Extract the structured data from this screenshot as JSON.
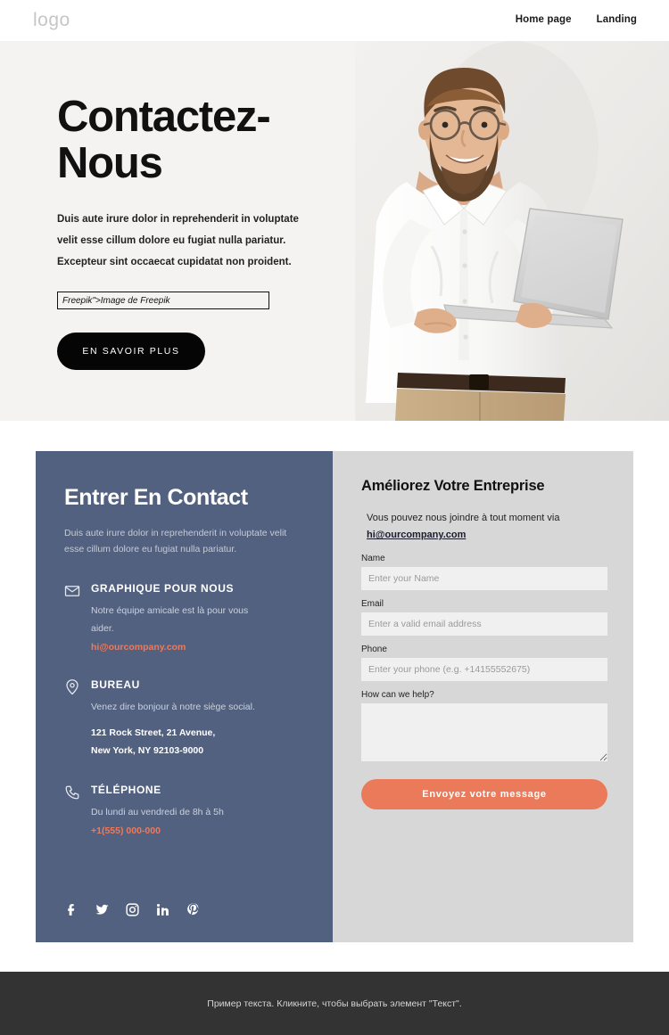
{
  "header": {
    "logo": "logo",
    "nav": [
      {
        "label": "Home page"
      },
      {
        "label": "Landing"
      }
    ]
  },
  "hero": {
    "title_line1": "Contactez-",
    "title_line2": "Nous",
    "paragraph_line1": "Duis aute irure dolor in reprehenderit in voluptate",
    "paragraph_line2": "velit esse cillum dolore eu fugiat nulla pariatur.",
    "paragraph_line3": "Excepteur sint occaecat cupidatat non proident.",
    "credit": "Freepik\">Image de Freepik",
    "cta_label": "EN SAVOIR PLUS",
    "image_alt": "Smiling bearded man with glasses in a white shirt holding a silver laptop",
    "background_color": "#f4f3f1"
  },
  "contact": {
    "left": {
      "title": "Entrer En Contact",
      "subtitle_line1": "Duis aute irure dolor in reprehenderit in voluptate velit",
      "subtitle_line2": "esse cillum dolore eu fugiat nulla pariatur.",
      "background_color": "#526180",
      "blocks": [
        {
          "icon": "envelope-icon",
          "heading": "GRAPHIQUE POUR NOUS",
          "line1": "Notre équipe amicale est là pour vous",
          "line2": "aider.",
          "link": "hi@ourcompany.com"
        },
        {
          "icon": "map-pin-icon",
          "heading": "BUREAU",
          "line1": "Venez dire bonjour à notre siège social.",
          "line2": "121 Rock Street, 21 Avenue,",
          "line3": "New York, NY 92103-9000"
        },
        {
          "icon": "phone-icon",
          "heading": "TÉLÉPHONE",
          "line1": "Du lundi au vendredi de 8h à 5h",
          "link": "+1(555) 000-000"
        }
      ],
      "socials": [
        {
          "name": "facebook-icon"
        },
        {
          "name": "twitter-icon"
        },
        {
          "name": "instagram-icon"
        },
        {
          "name": "linkedin-icon"
        },
        {
          "name": "pinterest-icon"
        }
      ],
      "link_color": "#ec7a5c"
    },
    "right": {
      "title": "Améliorez Votre Entreprise",
      "intro_text": "Vous pouvez nous joindre à tout moment via",
      "intro_email": "hi@ourcompany.com",
      "background_color": "#d7d7d7",
      "fields": [
        {
          "label": "Name",
          "placeholder": "Enter your Name",
          "value": ""
        },
        {
          "label": "Email",
          "placeholder": "Enter a valid email address",
          "value": ""
        },
        {
          "label": "Phone",
          "placeholder": "Enter your phone (e.g. +14155552675)",
          "value": ""
        }
      ],
      "message_label": "How can we help?",
      "message_value": "",
      "submit_label": "Envoyez votre message",
      "submit_color": "#eb7a5b"
    }
  },
  "footer": {
    "text": "Пример текста. Кликните, чтобы выбрать элемент \"Текст\".",
    "background_color": "#333333"
  }
}
